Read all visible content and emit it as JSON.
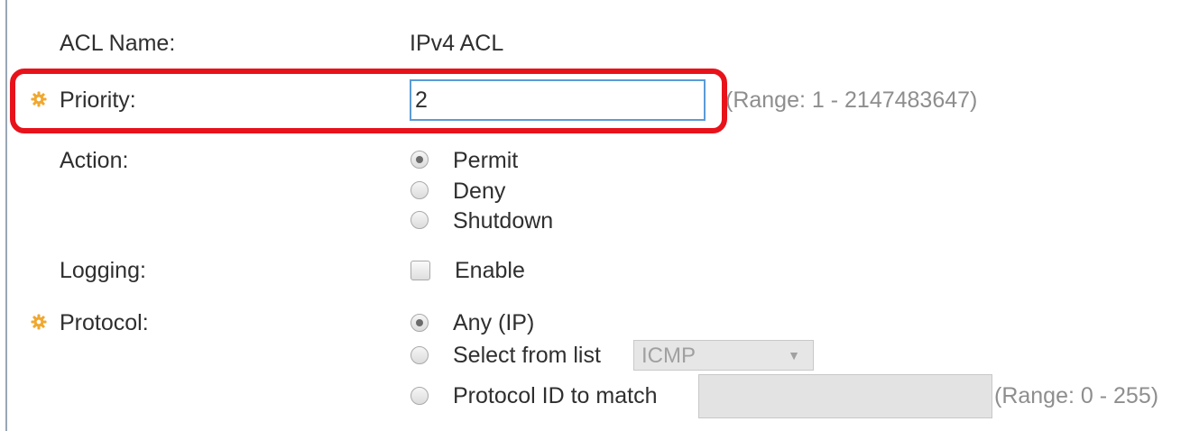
{
  "form": {
    "acl_name": {
      "label": "ACL Name:",
      "value": "IPv4 ACL"
    },
    "priority": {
      "label": "Priority:",
      "value": "2",
      "hint": "(Range: 1 - 2147483647)"
    },
    "action": {
      "label": "Action:",
      "options": [
        "Permit",
        "Deny",
        "Shutdown"
      ],
      "selected": "Permit"
    },
    "logging": {
      "label": "Logging:",
      "checkbox_label": "Enable",
      "checked": false
    },
    "protocol": {
      "label": "Protocol:",
      "options": [
        "Any (IP)",
        "Select from list",
        "Protocol ID to match"
      ],
      "selected": "Any (IP)",
      "list_select_value": "ICMP",
      "protocol_id_value": "",
      "protocol_id_hint": "(Range: 0 - 255)"
    }
  },
  "colors": {
    "highlight": "#e8121b",
    "required_icon": "#f0a830",
    "input_focus_border": "#5b9bd5"
  },
  "icons": {
    "required": "gear-icon"
  }
}
